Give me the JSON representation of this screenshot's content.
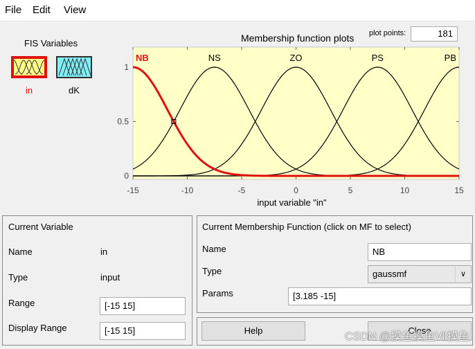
{
  "menu": [
    {
      "label": "File"
    },
    {
      "label": "Edit"
    },
    {
      "label": "View"
    }
  ],
  "fis_variables": {
    "title": "FIS Variables",
    "inputs": [
      {
        "label": "in"
      }
    ],
    "outputs": [
      {
        "label": "dK"
      }
    ]
  },
  "plot": {
    "title": "Membership function plots",
    "plot_points_label": "plot points:",
    "plot_points_value": "181"
  },
  "chart_data": {
    "type": "line",
    "xlabel": "input variable \"in\"",
    "ylabel": "",
    "xlim": [
      -15,
      15
    ],
    "ylim": [
      0,
      1
    ],
    "x_ticks": [
      -15,
      -10,
      -5,
      0,
      5,
      10,
      15
    ],
    "y_ticks": [
      0,
      0.5,
      1
    ],
    "grid": false,
    "series": [
      {
        "name": "NB",
        "mf": "gaussmf",
        "sigma": 3.185,
        "center": -15,
        "selected": true
      },
      {
        "name": "NS",
        "mf": "gaussmf",
        "sigma": 3.185,
        "center": -7.5,
        "selected": false
      },
      {
        "name": "ZO",
        "mf": "gaussmf",
        "sigma": 3.185,
        "center": 0,
        "selected": false
      },
      {
        "name": "PS",
        "mf": "gaussmf",
        "sigma": 3.185,
        "center": 7.5,
        "selected": false
      },
      {
        "name": "PB",
        "mf": "gaussmf",
        "sigma": 3.185,
        "center": 15,
        "selected": false
      }
    ],
    "colors": {
      "background": "#ffffc8",
      "selected": "#e01010",
      "normal": "#000000"
    }
  },
  "current_variable": {
    "title": "Current Variable",
    "name_label": "Name",
    "name_value": "in",
    "type_label": "Type",
    "type_value": "input",
    "range_label": "Range",
    "range_value": "[-15 15]",
    "display_range_label": "Display Range",
    "display_range_value": "[-15 15]"
  },
  "current_mf": {
    "title": "Current Membership Function (click on MF to select)",
    "name_label": "Name",
    "name_value": "NB",
    "type_label": "Type",
    "type_value": "gaussmf",
    "params_label": "Params",
    "params_value": "[3.185 -15]"
  },
  "buttons": {
    "help": "Help",
    "close": "Close"
  },
  "watermark": "CSDN @摸鱼摸鱼Ⅶ摸鱼"
}
